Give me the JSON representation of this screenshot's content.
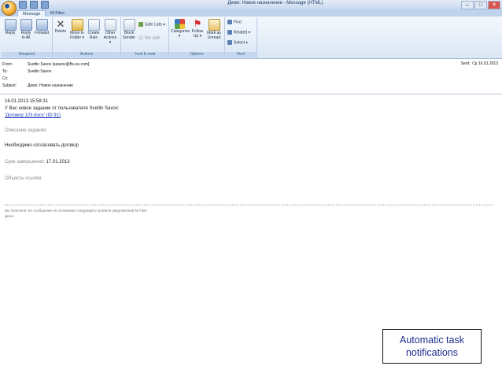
{
  "window": {
    "title": "Демо: Новое назначение - Message (HTML)",
    "controls": [
      "–",
      "□",
      "✕"
    ]
  },
  "tabs": [
    {
      "label": "Message"
    },
    {
      "label": "M-Files"
    }
  ],
  "ribbon": {
    "groups": [
      {
        "label": "Respond",
        "buttons": [
          "Reply",
          "Reply\nto All",
          "Forward"
        ]
      },
      {
        "label": "Actions",
        "buttons": [
          "Delete",
          "Move to\nFolder ▾",
          "Create\nRule",
          "Other\nActions ▾"
        ]
      },
      {
        "label": "Junk E-mail",
        "buttons": [
          "Block\nSender"
        ],
        "small": [
          "Safe Lists ▾",
          "Not Junk"
        ]
      },
      {
        "label": "Options",
        "buttons": [
          "Categorize\n▾",
          "Follow\nUp ▾",
          "Mark as\nUnread"
        ]
      },
      {
        "label": "Find",
        "small": [
          "Find",
          "Related ▾",
          "Select ▾"
        ]
      }
    ]
  },
  "header": {
    "from_label": "From:",
    "from_value": "Svetlin Savov [ssavov@fts-eu.com]",
    "to_label": "To:",
    "to_value": "Svetlin Savov",
    "cc_label": "Cc:",
    "cc_value": "",
    "subject_label": "Subject:",
    "subject_value": "Демо: Новое назначение",
    "sent_label": "Sent:",
    "sent_value": "Ср 16.01.2013"
  },
  "body": {
    "timestamp": "16.01.2013 15:58:31",
    "intro": "У Вас новое задание от пользователя Svetlin Savov:",
    "link": "'Договор 123.docx' (ID 91)",
    "desc_label": "Описание задания:",
    "desc_value": "Необходимо согласовать договор",
    "deadline_label": "Срок завершения:",
    "deadline_value": "17.01.2013",
    "objects_label": "Объекты ссылки:",
    "footer_1": "Вы получили это сообщение на основании следующего правила уведомлений M-Files:",
    "footer_2": "Демо:"
  },
  "callout": {
    "text": "Automatic task notifications"
  },
  "icons": [
    "office-button",
    "save-icon",
    "undo-icon",
    "redo-icon",
    "reply-icon",
    "reply-all-icon",
    "forward-icon",
    "delete-icon",
    "move-folder-icon",
    "create-rule-icon",
    "other-actions-icon",
    "block-sender-icon",
    "safe-lists-icon",
    "not-junk-icon",
    "categorize-icon",
    "follow-up-icon",
    "mark-unread-icon",
    "find-icon",
    "related-icon",
    "select-icon"
  ]
}
